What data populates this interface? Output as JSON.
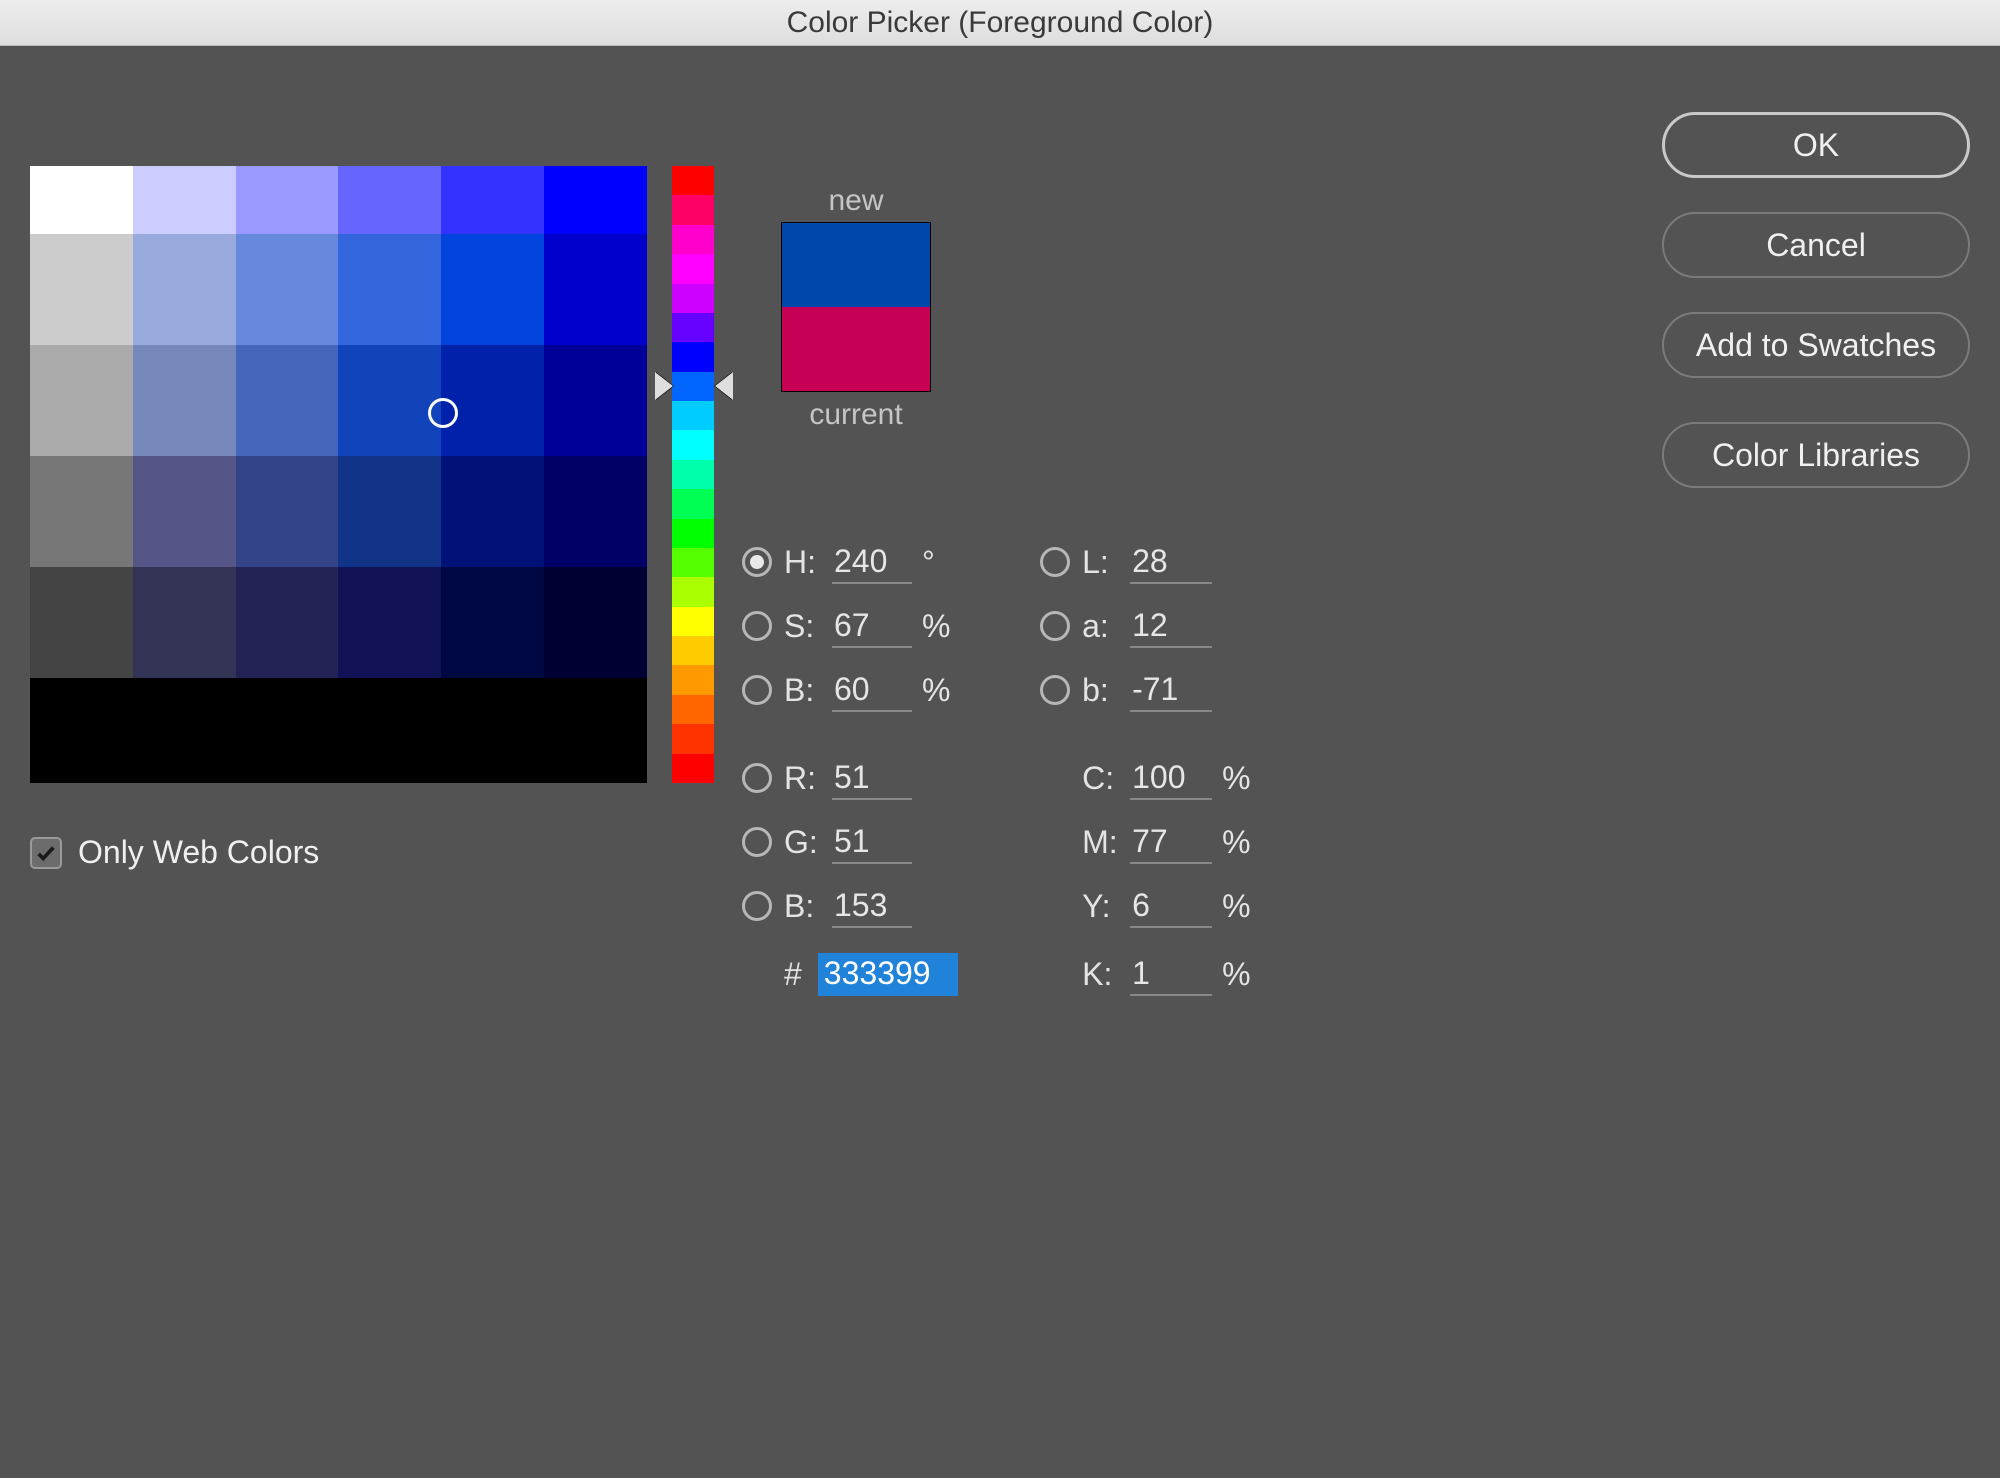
{
  "window": {
    "title": "Color Picker (Foreground Color)"
  },
  "swatch": {
    "new_label": "new",
    "current_label": "current",
    "new_color": "#0047ab",
    "current_color": "#c60054"
  },
  "buttons": {
    "ok": "OK",
    "cancel": "Cancel",
    "add_swatches": "Add to Swatches",
    "libraries": "Color Libraries"
  },
  "fields": {
    "H_label": "H:",
    "H": "240",
    "H_unit": "°",
    "S_label": "S:",
    "S": "67",
    "S_unit": "%",
    "Bv_label": "B:",
    "Bv": "60",
    "Bv_unit": "%",
    "R_label": "R:",
    "R": "51",
    "G_label": "G:",
    "G": "51",
    "Bc_label": "B:",
    "Bc": "153",
    "L_label": "L:",
    "L": "28",
    "a_label": "a:",
    "a": "12",
    "b_label": "b:",
    "b": "-71",
    "C_label": "C:",
    "C": "100",
    "C_unit": "%",
    "M_label": "M:",
    "M": "77",
    "M_unit": "%",
    "Y_label": "Y:",
    "Y": "6",
    "Y_unit": "%",
    "K_label": "K:",
    "K": "1",
    "K_unit": "%",
    "hex_hash": "#",
    "hex": "333399"
  },
  "only_web": {
    "label": "Only Web Colors",
    "checked": true
  },
  "selected_radio": "H",
  "cursor": {
    "s": 67,
    "b": 60
  },
  "hue_pos_pct": 33.7
}
